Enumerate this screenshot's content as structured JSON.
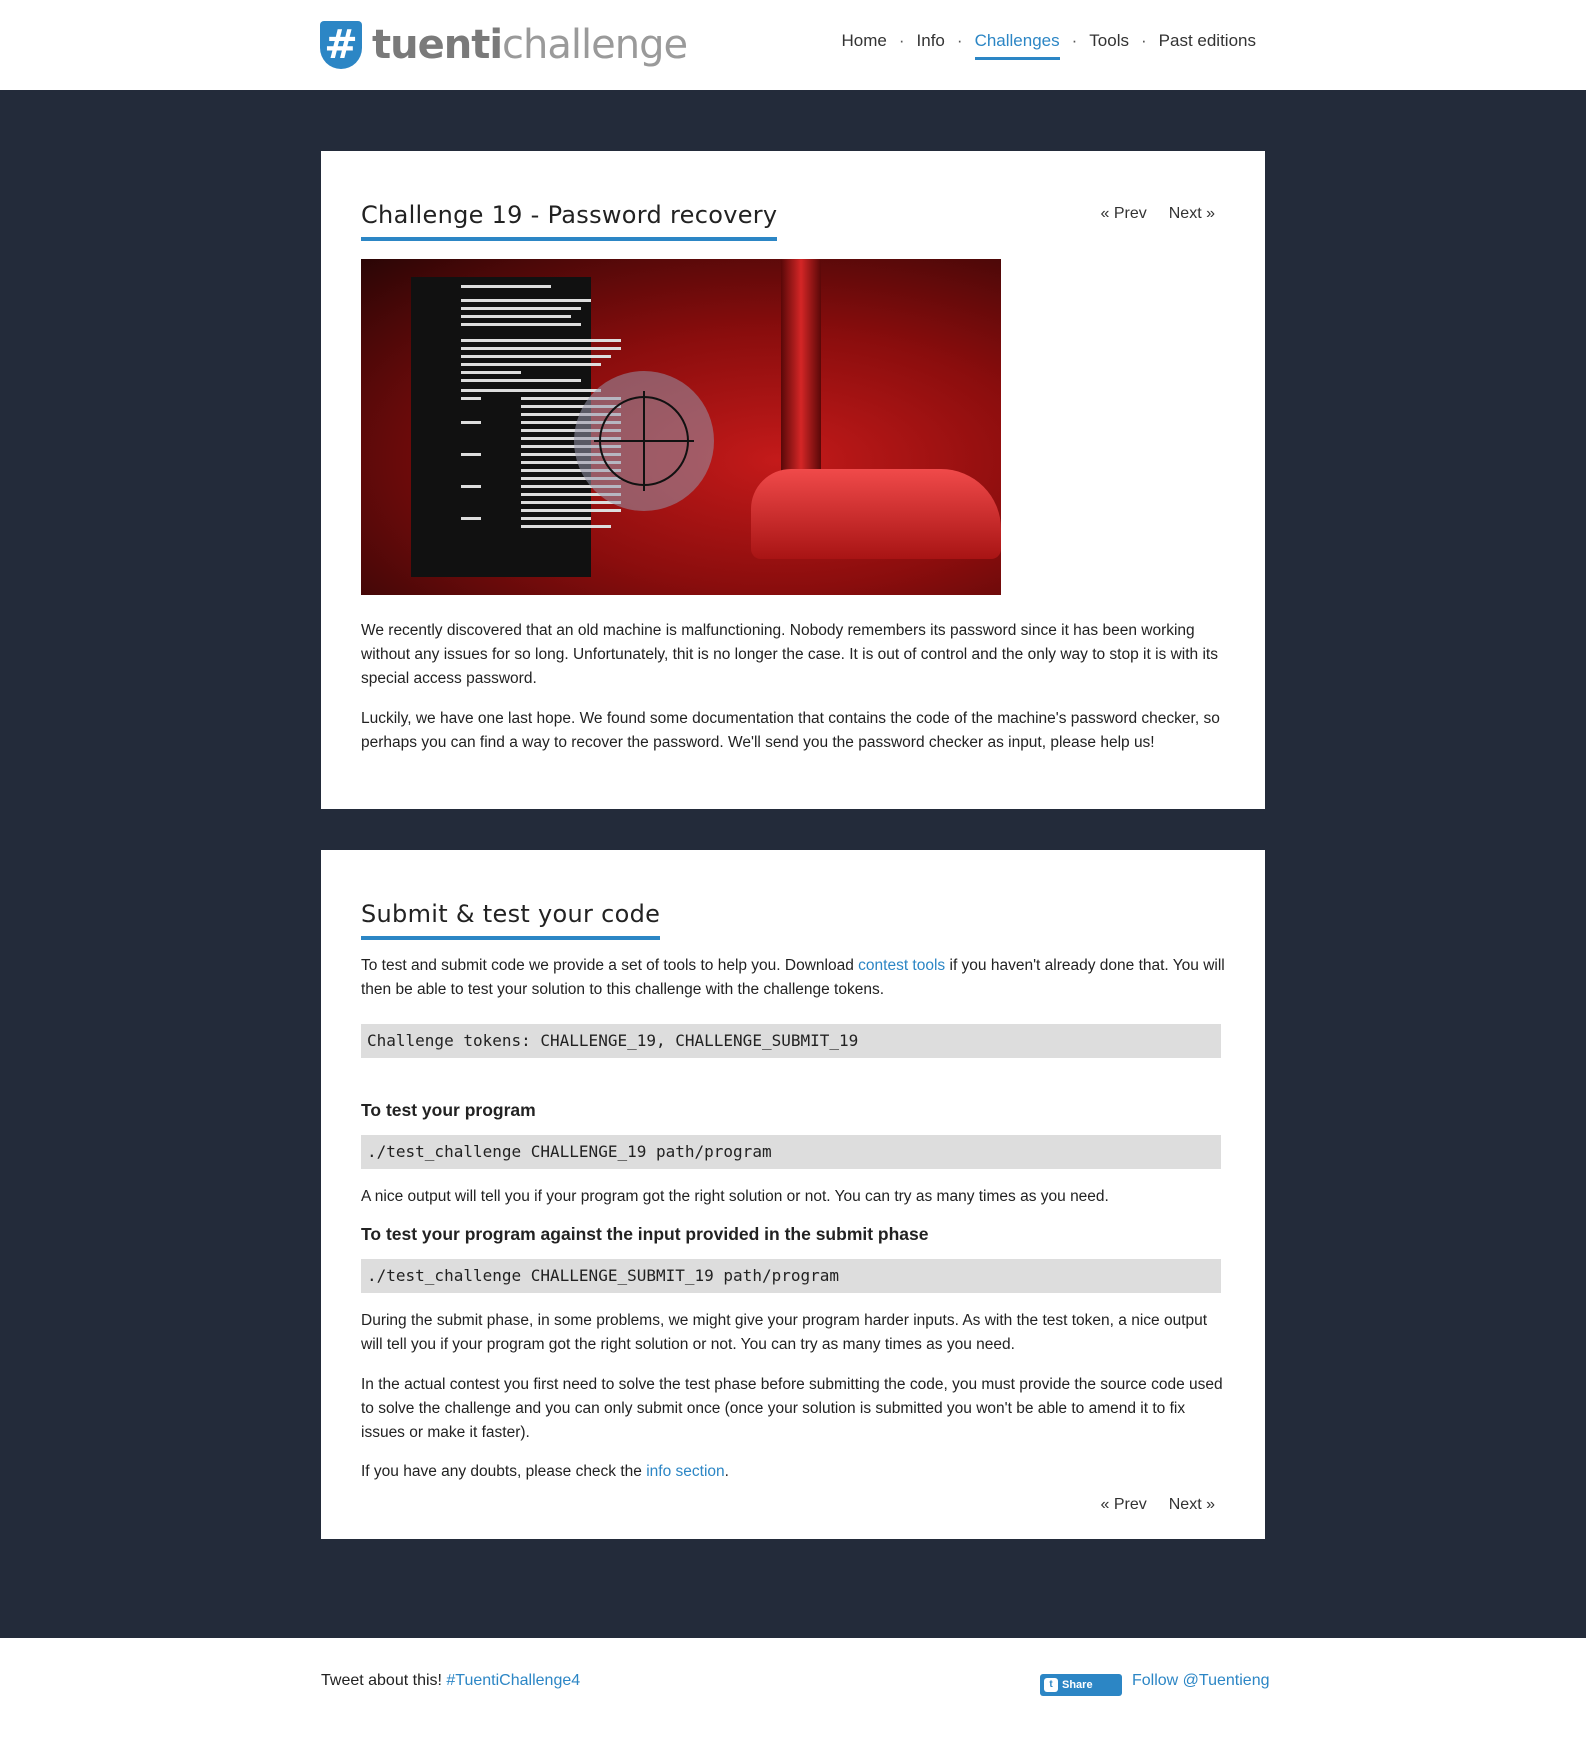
{
  "logo": {
    "badge": "#",
    "text_bold": "tuenti",
    "text_light": "challenge"
  },
  "nav": {
    "items": [
      "Home",
      "Info",
      "Challenges",
      "Tools",
      "Past editions"
    ],
    "active": "Challenges",
    "separator": "·"
  },
  "pager": {
    "prev": "« Prev",
    "next": "Next »"
  },
  "challenge": {
    "title": "Challenge 19 - Password recovery",
    "paragraph1": "We recently discovered that an old machine is malfunctioning. Nobody remembers its password since it has been working without any issues for so long. Unfortunately, thit is no longer the case. It is out of control and the only way to stop it is with its special access password.",
    "paragraph2": "Luckily, we have one last hope. We found some documentation that contains the code of the machine's password checker, so perhaps you can find a way to recover the password. We'll send you the password checker as input, please help us!"
  },
  "submit": {
    "title": "Submit & test your code",
    "intro_before": "To test and submit code we provide a set of tools to help you. Download ",
    "intro_link": "contest tools",
    "intro_after": " if you haven't already done that. You will then be able to test your solution to this challenge with the challenge tokens.",
    "tokens_code": "Challenge tokens: CHALLENGE_19, CHALLENGE_SUBMIT_19",
    "test_heading": "To test your program",
    "test_code": "./test_challenge CHALLENGE_19 path/program",
    "test_note": "A nice output will tell you if your program got the right solution or not. You can try as many times as you need.",
    "submit_heading": "To test your program against the input provided in the submit phase",
    "submit_code": "./test_challenge CHALLENGE_SUBMIT_19 path/program",
    "submit_note": "During the submit phase, in some problems, we might give your program harder inputs. As with the test token, a nice output will tell you if your program got the right solution or not. You can try as many times as you need.",
    "contest_note": "In the actual contest you first need to solve the test phase before submitting the code, you must provide the source code used to solve the challenge and you can only submit once (once your solution is submitted you won't be able to amend it to fix issues or make it faster).",
    "doubts_before": "If you have any doubts, please check the ",
    "doubts_link": "info section",
    "doubts_after": "."
  },
  "footer": {
    "tweet_text": "Tweet about this! ",
    "hashtag": "#TuentiChallenge4",
    "share_label": "Share",
    "follow_label": "Follow @Tuentieng"
  },
  "colors": {
    "accent": "#2c86c5",
    "background_dark": "#232b3a",
    "code_bg": "#dddddd"
  }
}
